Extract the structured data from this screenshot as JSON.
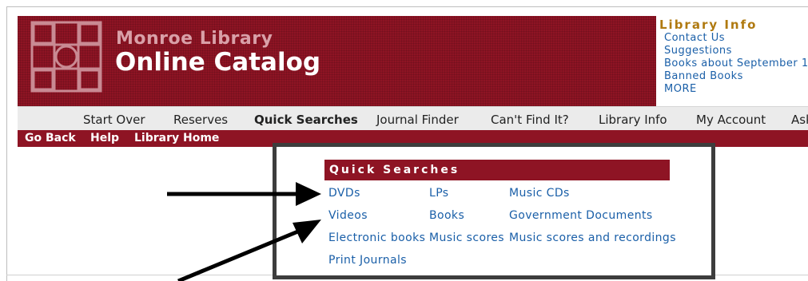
{
  "header": {
    "title_small": "Monroe Library",
    "title_big": "Online Catalog"
  },
  "library_info": {
    "heading": "Library Info",
    "links": [
      "Contact Us",
      "Suggestions",
      "Books about September 1",
      "Banned Books",
      "MORE"
    ]
  },
  "nav": {
    "items": [
      "Start Over",
      "Reserves",
      "Quick Searches",
      "Journal Finder",
      "Can't Find It?",
      "Library Info",
      "My Account",
      "Ask"
    ]
  },
  "subnav": {
    "items": [
      "Go Back",
      "Help",
      "Library Home"
    ]
  },
  "quick_searches": {
    "title": "Quick Searches",
    "links": [
      "DVDs",
      "LPs",
      "Music CDs",
      "Videos",
      "Books",
      "Government Documents",
      "Electronic books",
      "Music scores",
      "Music scores and recordings",
      "Print Journals"
    ]
  },
  "colors": {
    "banner": "#8e1424",
    "link": "#1a5fa8",
    "info_heading": "#b07a10",
    "navbar": "#ebebeb",
    "highlight_border": "#3d3d3d"
  }
}
